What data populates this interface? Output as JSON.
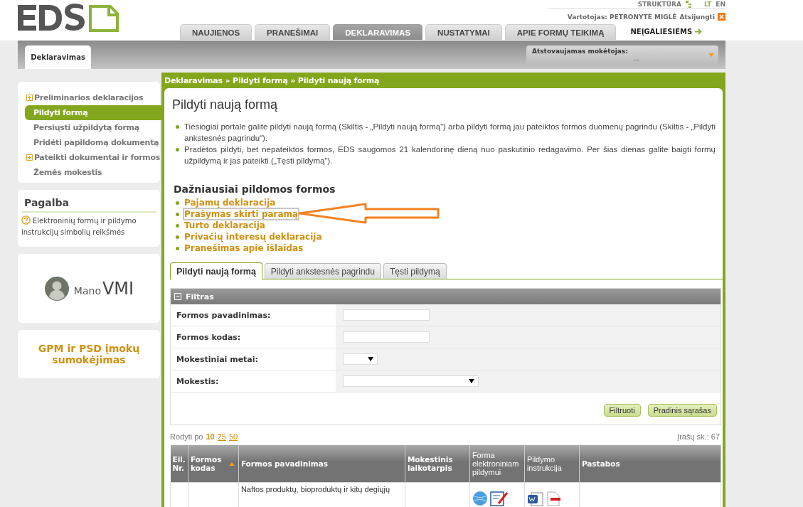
{
  "top_links": {
    "structure": "STRUKTŪRA",
    "languages": [
      {
        "label": "LT",
        "selected": true
      },
      {
        "label": "EN",
        "selected": false
      }
    ]
  },
  "user": {
    "label": "Vartotojas: PETRONYTĖ MIGLĖ",
    "logout": "Atsijungti"
  },
  "tabs": [
    {
      "label": "NAUJIENOS",
      "selected": false
    },
    {
      "label": "PRANEŠIMAI",
      "selected": false
    },
    {
      "label": "DEKLARAVIMAS",
      "selected": true
    },
    {
      "label": "NUSTATYMAI",
      "selected": false
    },
    {
      "label": "APIE FORMŲ TEIKIMĄ",
      "selected": false
    }
  ],
  "accessibility_link": "NEĮGALIESIEMS",
  "section_tab": "Deklaravimas",
  "payer": {
    "label": "Atstovaujamas mokėtojas:",
    "value": "..."
  },
  "sidebar": {
    "items": [
      {
        "label": "Preliminarios deklaracijos",
        "expandable": true,
        "selected": false
      },
      {
        "label": "Pildyti formą",
        "expandable": false,
        "selected": true
      },
      {
        "label": "Persiųsti užpildytą formą",
        "expandable": false,
        "selected": false
      },
      {
        "label": "Pridėti papildomą dokumentą",
        "expandable": false,
        "selected": false
      },
      {
        "label": "Pateikti dokumentai ir formos",
        "expandable": true,
        "selected": false
      },
      {
        "label": "Žemės mokestis",
        "expandable": false,
        "selected": false
      }
    ],
    "help": {
      "title": "Pagalba",
      "link": "Elektroninių formų ir pildymo instrukcijų simbolių reikšmės"
    },
    "mano_vmi": {
      "prefix": "Mano",
      "name": "VMI"
    },
    "gpm_link": "GPM ir PSD įmokų sumokėjimas"
  },
  "breadcrumb": "Deklaravimas » Pildyti formą » Pildyti naują formą",
  "page_title": "Pildyti naują formą",
  "info": [
    "Tiesiogiai portale galite pildyti naują formą (Skiltis - „Pildyti naują formą“) arba pildyti formą jau pateiktos formos duomenų pagrindu (Skiltis - „Pildyti ankstesnės pagrindu“).",
    "Pradėtos pildyti, bet nepateiktos formos, EDS saugomos 21 kalendorinę dieną nuo paskutinio redagavimo. Per šias dienas galite baigti formų užpildymą ir jas pateikti („Tęsti pildymą“)."
  ],
  "frequent": {
    "title": "Dažniausiai pildomos formos",
    "links": [
      {
        "label": "Pajamų deklaracija",
        "highlighted": false
      },
      {
        "label": "Prašymas skirti paramą",
        "highlighted": true
      },
      {
        "label": "Turto deklaracija",
        "highlighted": false
      },
      {
        "label": "Privačių interesų deklaracija",
        "highlighted": false
      },
      {
        "label": "Pranešimas apie išlaidas",
        "highlighted": false
      }
    ]
  },
  "form_tabs": [
    {
      "label": "Pildyti naują formą",
      "selected": true
    },
    {
      "label": "Pildyti ankstesnės pagrindu",
      "selected": false
    },
    {
      "label": "Tęsti pildymą",
      "selected": false
    }
  ],
  "filter": {
    "title": "Filtras",
    "fields": [
      {
        "label": "Formos pavadinimas:",
        "kind": "text"
      },
      {
        "label": "Formos kodas:",
        "kind": "text"
      },
      {
        "label": "Mokestiniai metai:",
        "kind": "select_small"
      },
      {
        "label": "Mokestis:",
        "kind": "select"
      }
    ],
    "buttons": [
      "Filtruoti",
      "Pradinis sąrašas"
    ]
  },
  "paging": {
    "label": "Rodyti po",
    "sizes": [
      {
        "label": "10",
        "selected": true
      },
      {
        "label": "25",
        "selected": false
      },
      {
        "label": "50",
        "selected": false
      }
    ],
    "count": "Įrašų sk.: 67"
  },
  "table": {
    "columns": [
      {
        "label": "Eil. Nr.",
        "sorted": false,
        "bold": true
      },
      {
        "label": "Formos kodas",
        "sorted": true,
        "bold": true
      },
      {
        "label": "Formos pavadinimas",
        "sorted": false,
        "bold": true
      },
      {
        "label": "Mokestinis laikotarpis",
        "sorted": false,
        "bold": true
      },
      {
        "label": "Forma elektroniniam pildymui",
        "sorted": false,
        "bold": false
      },
      {
        "label": "Pildymo instrukcija",
        "sorted": false,
        "bold": false
      },
      {
        "label": "Pastabos",
        "sorted": false,
        "bold": true
      }
    ],
    "rows": [
      {
        "number": "",
        "code": "",
        "name": "Naftos produktų, bioproduktų ir kitų degiųjų",
        "period": "",
        "note": ""
      }
    ]
  }
}
